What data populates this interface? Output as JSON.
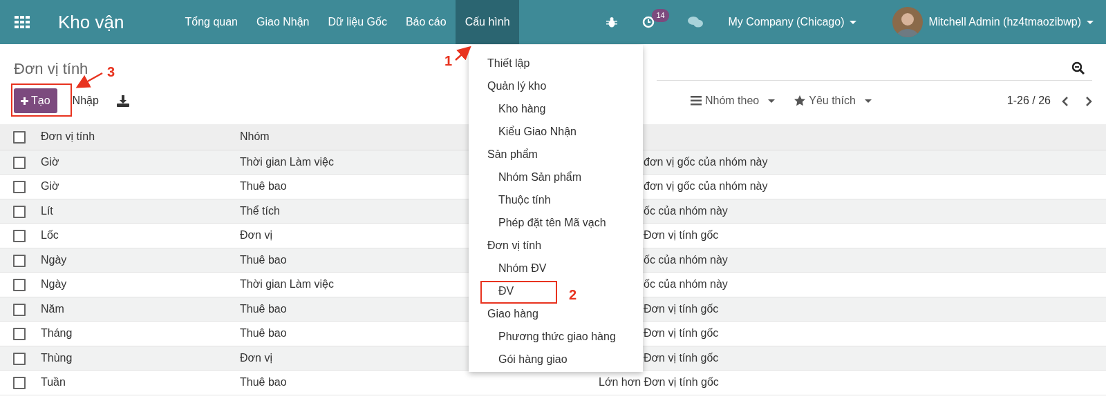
{
  "navbar": {
    "brand": "Kho vận",
    "menu": [
      {
        "label": "Tổng quan",
        "selected": false
      },
      {
        "label": "Giao Nhận",
        "selected": false
      },
      {
        "label": "Dữ liệu Gốc",
        "selected": false
      },
      {
        "label": "Báo cáo",
        "selected": false
      },
      {
        "label": "Cấu hình",
        "selected": true
      }
    ],
    "activity_count": "14",
    "company": "My Company (Chicago)",
    "user": "Mitchell Admin (hz4tmaozibwp)"
  },
  "page_title": "Đơn vị tính",
  "toolbar": {
    "create": "Tạo",
    "import": "Nhập",
    "group_by": "Nhóm theo",
    "favorites": "Yêu thích",
    "pager": "1-26 / 26"
  },
  "table": {
    "select_all_checked": false,
    "columns": [
      "Đơn vị tính",
      "Nhóm"
    ],
    "rows": [
      {
        "checked": false,
        "name": "Giờ",
        "group": "Thời gian Làm việc",
        "column_3": "đơn vị gốc của nhóm này",
        "covered": true
      },
      {
        "checked": false,
        "name": "Giờ",
        "group": "Thuê bao",
        "column_3": "đơn vị gốc của nhóm này",
        "covered": true
      },
      {
        "checked": false,
        "name": "Lít",
        "group": "Thể tích",
        "column_3": "ốc của nhóm này",
        "covered": true
      },
      {
        "checked": false,
        "name": "Lốc",
        "group": "Đơn vị",
        "column_3": "Đơn vị tính gốc",
        "covered": true
      },
      {
        "checked": false,
        "name": "Ngày",
        "group": "Thuê bao",
        "column_3": "ốc của nhóm này",
        "covered": true
      },
      {
        "checked": false,
        "name": "Ngày",
        "group": "Thời gian Làm việc",
        "column_3": "ốc của nhóm này",
        "covered": true
      },
      {
        "checked": false,
        "name": "Năm",
        "group": "Thuê bao",
        "column_3": "Đơn vị tính gốc",
        "covered": true
      },
      {
        "checked": false,
        "name": "Tháng",
        "group": "Thuê bao",
        "column_3": "Đơn vị tính gốc",
        "covered": true
      },
      {
        "checked": false,
        "name": "Thùng",
        "group": "Đơn vị",
        "column_3": "Đơn vị tính gốc",
        "covered": true
      },
      {
        "checked": false,
        "name": "Tuần",
        "group": "Thuê bao",
        "column_3": "Lớn hơn Đơn vị tính gốc",
        "covered": false
      }
    ]
  },
  "dropdown": [
    {
      "label": "Thiết lập"
    },
    {
      "label": "Quản lý kho",
      "children": [
        {
          "label": "Kho hàng"
        },
        {
          "label": "Kiểu Giao Nhận"
        }
      ]
    },
    {
      "label": "Sản phẩm",
      "children": [
        {
          "label": "Nhóm Sản phẩm"
        },
        {
          "label": "Thuộc tính"
        },
        {
          "label": "Phép đặt tên Mã vạch"
        }
      ]
    },
    {
      "label": "Đơn vị tính",
      "children": [
        {
          "label": "Nhóm ĐV"
        },
        {
          "label": "ĐV"
        }
      ]
    },
    {
      "label": "Giao hàng",
      "children": [
        {
          "label": "Phương thức giao hàng"
        },
        {
          "label": "Gói hàng giao"
        }
      ]
    }
  ],
  "annotations": [
    {
      "label": "1"
    },
    {
      "label": "2"
    },
    {
      "label": "3"
    }
  ]
}
